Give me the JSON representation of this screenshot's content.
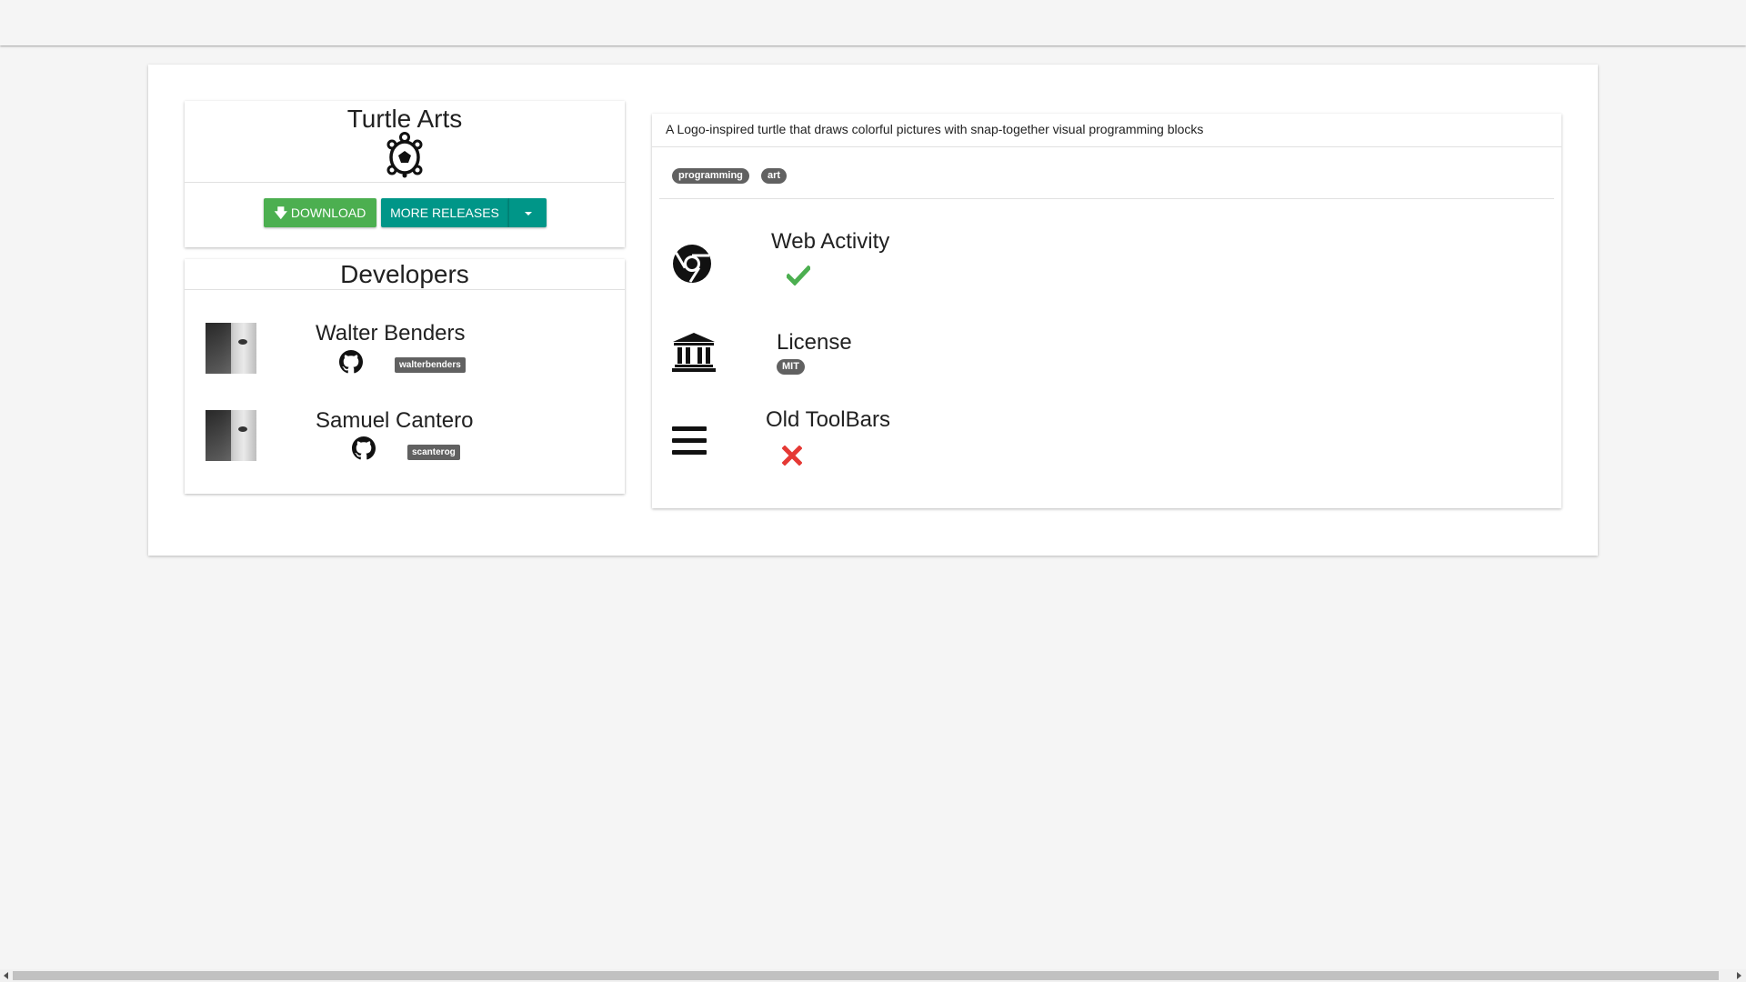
{
  "app": {
    "title": "Turtle Arts",
    "icon": "turtle-icon",
    "download_label": "DOWNLOAD",
    "more_releases_label": "MORE RELEASES"
  },
  "developers": {
    "title": "Developers",
    "items": [
      {
        "name": "Walter Benders",
        "github_handle": "walterbenders"
      },
      {
        "name": "Samuel Cantero",
        "github_handle": "scanterog"
      }
    ]
  },
  "info": {
    "description": "A Logo-inspired turtle that draws colorful pictures with snap-together visual programming blocks",
    "tags": [
      "programming",
      "art"
    ],
    "features": [
      {
        "title": "Web Activity",
        "icon": "chrome-icon",
        "status": "check-icon",
        "status_color": "#4caf50"
      },
      {
        "title": "License",
        "icon": "bank-icon",
        "value": "MIT"
      },
      {
        "title": "Old ToolBars",
        "icon": "menu-icon",
        "status": "cross-icon",
        "status_color": "#e53935"
      }
    ]
  },
  "colors": {
    "download": "#4caf50",
    "more_releases": "#009688",
    "badge": "#616161"
  }
}
